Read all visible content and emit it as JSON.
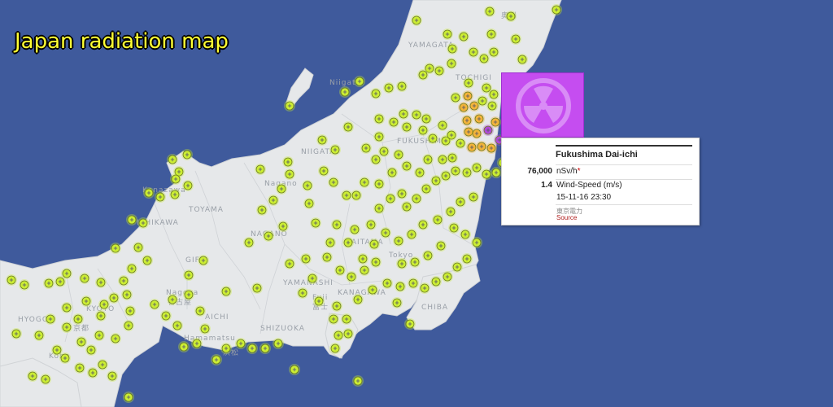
{
  "title": "Japan radiation map",
  "colors": {
    "sea": "#3f5a9c",
    "land": "#e6e8ea",
    "title": "#ffff33",
    "plant": "#c54df0",
    "sensor_low": "#ccee33",
    "sensor_mid": "#f4b43a",
    "sensor_high": "#b04ad8"
  },
  "map_labels": [
    "YAMAGATA",
    "Niigata",
    "NIIGATA",
    "FUKUSHIMA",
    "TOYAMA",
    "ISHIKAWA",
    "Kanazawa",
    "Nagano",
    "NAGANO",
    "TOCHIGI",
    "GIFU",
    "SAITAMA",
    "Tokyo",
    "YAMANASHI",
    "KANAGAWA",
    "AICHI",
    "Nagoya",
    "名古屋",
    "SHIZUOKA",
    "CHIBA",
    "Hamamatsu",
    "浜松",
    "Fuji",
    "富士",
    "KYOTO",
    "京都",
    "HYOGO",
    "Kobe",
    "奥州"
  ],
  "popup": {
    "name": "Fukushima Dai-ichi",
    "reading_value": "76,000",
    "reading_unit": "nSv/h",
    "reading_flag": "*",
    "wind_value": "1.4",
    "wind_label": "Wind-Speed (m/s)",
    "timestamp": "15-11-16 23:30",
    "source_jp": "東京電力",
    "source_link": "Source"
  }
}
